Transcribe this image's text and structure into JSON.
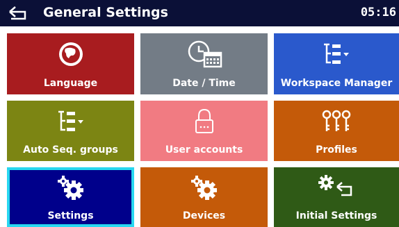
{
  "header": {
    "title": "General Settings",
    "time": "05:16",
    "back_icon": "back-arrow-icon"
  },
  "tiles": [
    {
      "label": "Language",
      "icon": "globe-icon",
      "color": "#a81c1f"
    },
    {
      "label": "Date / Time",
      "icon": "clock-calendar-icon",
      "color": "#737c86"
    },
    {
      "label": "Workspace Manager",
      "icon": "tree-list-icon",
      "color": "#2a59cc"
    },
    {
      "label": "Auto Seq. groups",
      "icon": "tree-list-icon",
      "color": "#7c8513"
    },
    {
      "label": "User accounts",
      "icon": "lock-icon",
      "color": "#f17b82"
    },
    {
      "label": "Profiles",
      "icon": "keys-icon",
      "color": "#c45a09"
    },
    {
      "label": "Settings",
      "icon": "gears-icon",
      "color": "#00008b",
      "selected": true
    },
    {
      "label": "Devices",
      "icon": "gears-icon",
      "color": "#c45a09"
    },
    {
      "label": "Initial Settings",
      "icon": "gear-return-icon",
      "color": "#2f5a16"
    }
  ]
}
